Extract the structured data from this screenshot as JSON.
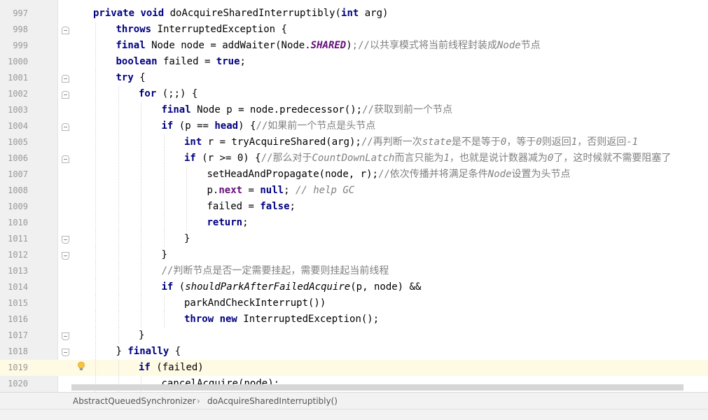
{
  "editor": {
    "current_line": "1019",
    "lines": [
      {
        "num": "997",
        "indent": 1,
        "tokens": [
          [
            "kw",
            "private "
          ],
          [
            "kw",
            "void "
          ],
          [
            "",
            "doAcquireSharedInterruptibly("
          ],
          [
            "kw",
            "int "
          ],
          [
            "",
            "arg)"
          ]
        ]
      },
      {
        "num": "998",
        "indent": 2,
        "fold": "start",
        "tokens": [
          [
            "kw",
            "throws "
          ],
          [
            "",
            "InterruptedException {"
          ]
        ]
      },
      {
        "num": "999",
        "indent": 2,
        "tokens": [
          [
            "kw",
            "final "
          ],
          [
            "",
            "Node node = addWaiter(Node."
          ],
          [
            "st",
            "SHARED"
          ],
          [
            "",
            ")"
          ],
          [
            "cz",
            ";//以共享模式将当前线程封装成"
          ],
          [
            "cm",
            "Node"
          ],
          [
            "cz",
            "节点"
          ]
        ]
      },
      {
        "num": "1000",
        "indent": 2,
        "tokens": [
          [
            "kw",
            "boolean "
          ],
          [
            "",
            "failed = "
          ],
          [
            "kw",
            "true"
          ],
          [
            "",
            ";"
          ]
        ]
      },
      {
        "num": "1001",
        "indent": 2,
        "fold": "start",
        "tokens": [
          [
            "kw",
            "try "
          ],
          [
            "",
            "{"
          ]
        ]
      },
      {
        "num": "1002",
        "indent": 3,
        "fold": "start",
        "tokens": [
          [
            "kw",
            "for "
          ],
          [
            "",
            "(;;) {"
          ]
        ]
      },
      {
        "num": "1003",
        "indent": 4,
        "tokens": [
          [
            "kw",
            "final "
          ],
          [
            "",
            "Node p = node.predecessor();"
          ],
          [
            "cz",
            "//获取到前一个节点"
          ]
        ]
      },
      {
        "num": "1004",
        "indent": 4,
        "fold": "start",
        "tokens": [
          [
            "kw",
            "if "
          ],
          [
            "",
            "(p == "
          ],
          [
            "kw",
            "head"
          ],
          [
            "",
            ") {"
          ],
          [
            "cz",
            "//如果前一个节点是头节点"
          ]
        ]
      },
      {
        "num": "1005",
        "indent": 5,
        "tokens": [
          [
            "kw",
            "int "
          ],
          [
            "",
            "r = tryAcquireShared(arg);"
          ],
          [
            "cz",
            "//再判断一次"
          ],
          [
            "cm",
            "state"
          ],
          [
            "cz",
            "是不是等于"
          ],
          [
            "cm",
            "0"
          ],
          [
            "cz",
            "，等于"
          ],
          [
            "cm",
            "0"
          ],
          [
            "cz",
            "则返回"
          ],
          [
            "cm",
            "1"
          ],
          [
            "cz",
            "，否则返回"
          ],
          [
            "cm",
            "-1"
          ]
        ]
      },
      {
        "num": "1006",
        "indent": 5,
        "fold": "start",
        "tokens": [
          [
            "kw",
            "if "
          ],
          [
            "",
            "(r >= 0) {"
          ],
          [
            "cz",
            "//那么对于"
          ],
          [
            "cm",
            "CountDownLatch"
          ],
          [
            "cz",
            "而言只能为"
          ],
          [
            "cm",
            "1"
          ],
          [
            "cz",
            "，也就是说计数器减为"
          ],
          [
            "cm",
            "0"
          ],
          [
            "cz",
            "了，这时候就不需要阻塞了"
          ]
        ]
      },
      {
        "num": "1007",
        "indent": 6,
        "tokens": [
          [
            "",
            "setHeadAndPropagate(node, r);"
          ],
          [
            "cz",
            "//依次传播并将满足条件"
          ],
          [
            "cm",
            "Node"
          ],
          [
            "cz",
            "设置为头节点"
          ]
        ]
      },
      {
        "num": "1008",
        "indent": 6,
        "tokens": [
          [
            "",
            "p."
          ],
          [
            "fld",
            "next"
          ],
          [
            "",
            " = "
          ],
          [
            "kw",
            "null"
          ],
          [
            "",
            "; "
          ],
          [
            "cm",
            "// help GC"
          ]
        ]
      },
      {
        "num": "1009",
        "indent": 6,
        "tokens": [
          [
            "",
            "failed = "
          ],
          [
            "kw",
            "false"
          ],
          [
            "",
            ";"
          ]
        ]
      },
      {
        "num": "1010",
        "indent": 6,
        "tokens": [
          [
            "kw",
            "return"
          ],
          [
            "",
            ";"
          ]
        ]
      },
      {
        "num": "1011",
        "indent": 5,
        "fold": "end",
        "tokens": [
          [
            "",
            "}"
          ]
        ]
      },
      {
        "num": "1012",
        "indent": 4,
        "fold": "end",
        "tokens": [
          [
            "",
            "}"
          ]
        ]
      },
      {
        "num": "1013",
        "indent": 4,
        "tokens": [
          [
            "cz",
            "//判断节点是否一定需要挂起，需要则挂起当前线程"
          ]
        ]
      },
      {
        "num": "1014",
        "indent": 4,
        "tokens": [
          [
            "kw",
            "if "
          ],
          [
            "",
            "("
          ],
          [
            "fn",
            "shouldParkAfterFailedAcquire"
          ],
          [
            "",
            "(p, node) &&"
          ]
        ]
      },
      {
        "num": "1015",
        "indent": 5,
        "tokens": [
          [
            "",
            "parkAndCheckInterrupt())"
          ]
        ]
      },
      {
        "num": "1016",
        "indent": 5,
        "tokens": [
          [
            "kw",
            "throw "
          ],
          [
            "kw",
            "new "
          ],
          [
            "",
            "InterruptedException();"
          ]
        ]
      },
      {
        "num": "1017",
        "indent": 3,
        "fold": "end",
        "tokens": [
          [
            "",
            "}"
          ]
        ]
      },
      {
        "num": "1018",
        "indent": 2,
        "fold": "end",
        "tokens": [
          [
            "",
            "} "
          ],
          [
            "kw",
            "finally "
          ],
          [
            "",
            "{"
          ]
        ]
      },
      {
        "num": "1019",
        "indent": 3,
        "bulb": true,
        "tokens": [
          [
            "kw",
            "if "
          ],
          [
            "",
            "(failed)"
          ]
        ]
      },
      {
        "num": "1020",
        "indent": 4,
        "tokens": [
          [
            "",
            "cancelAcquire(node);"
          ]
        ]
      }
    ]
  },
  "breadcrumb": {
    "class_name": "AbstractQueuedSynchronizer",
    "separator": "›",
    "method_name": "doAcquireSharedInterruptibly()"
  },
  "colors": {
    "keyword": "#000080",
    "comment": "#808080",
    "static_field": "#660e7a",
    "current_line_bg": "#fffae3"
  },
  "icons": {
    "fold_marker": "fold-marker-icon",
    "intention_bulb": "lightbulb-icon",
    "breadcrumb_separator": "chevron-right-icon"
  }
}
